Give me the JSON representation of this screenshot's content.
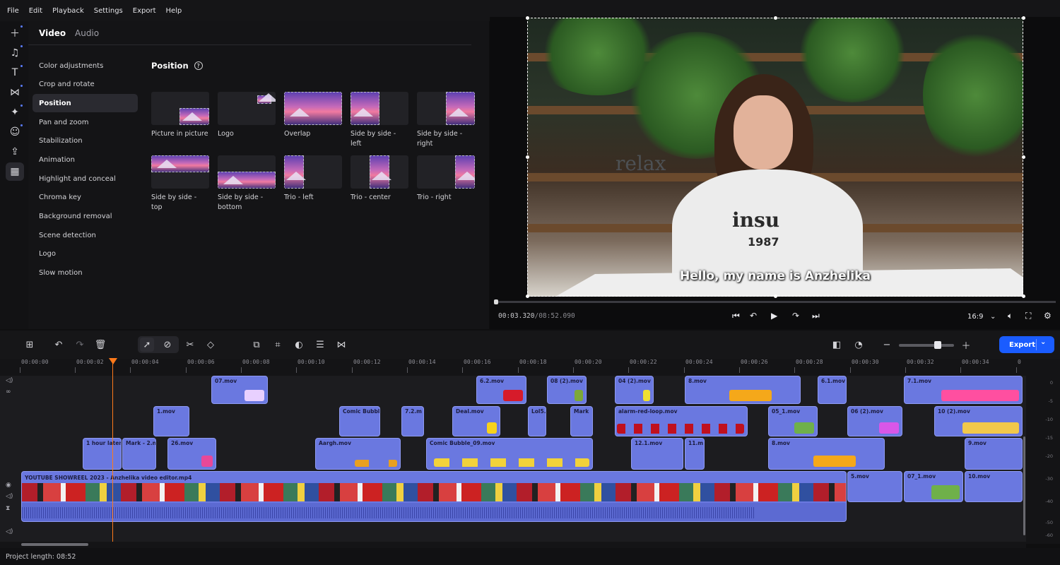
{
  "menu": [
    "File",
    "Edit",
    "Playback",
    "Settings",
    "Export",
    "Help"
  ],
  "rail_icons": [
    "add-icon",
    "music-icon",
    "text-icon",
    "transitions-icon",
    "effects-icon",
    "stickers-icon",
    "export-icon",
    "more-tools-icon"
  ],
  "panel": {
    "tabs": {
      "video": "Video",
      "audio": "Audio"
    },
    "categories": [
      "Color adjustments",
      "Crop and rotate",
      "Position",
      "Pan and zoom",
      "Stabilization",
      "Animation",
      "Highlight and conceal",
      "Chroma key",
      "Background removal",
      "Scene detection",
      "Logo",
      "Slow motion"
    ],
    "selected_category": "Position",
    "section_title": "Position",
    "help_glyph": "?",
    "presets": [
      "Picture in picture",
      "Logo",
      "Overlap",
      "Side by side - left",
      "Side by side - right",
      "Side by side - top",
      "Side by side - bottom",
      "Trio - left",
      "Trio - center",
      "Trio - right"
    ]
  },
  "viewer": {
    "caption": "Hello, my name is Anzhelika",
    "shirt_text": "insu",
    "shirt_number": "1987",
    "wall_text": "relax",
    "timecode_current": "00:03.320",
    "timecode_total": "/08:52.090",
    "aspect_ratio": "16:9",
    "ratio_caret": "⌄",
    "controls": [
      "⏮",
      "↶",
      "▶",
      "↷",
      "⏭"
    ]
  },
  "toolbar": {
    "export_label": "Export",
    "export_caret": "⌄"
  },
  "ruler": [
    "00:00:00",
    "00:00:02",
    "00:00:04",
    "00:00:06",
    "00:00:08",
    "00:00:10",
    "00:00:12",
    "00:00:14",
    "00:00:16",
    "00:00:18",
    "00:00:20",
    "00:00:22",
    "00:00:24",
    "00:00:26",
    "00:00:28",
    "00:00:30",
    "00:00:32",
    "00:00:34",
    "0"
  ],
  "clips": {
    "c07": "07.mov",
    "c62": "6.2.mov",
    "c08": "08 (2).mov",
    "c04": "04 (2).mov",
    "c8a": "8.mov",
    "c61": "6.1.mov",
    "c71": "7.1.mov",
    "c1": "1.mov",
    "cComic": "Comic Bubbl",
    "c72": "7.2.m",
    "cDeal": "Deal.mov",
    "cLol": "Lol5.",
    "cMark2": "Mark",
    "cAlarm": "alarm-red-loop.mov",
    "c051": "05_1.mov",
    "c062": "06 (2).mov",
    "c102": "10 (2).mov",
    "cHour": "1 hour later",
    "cMark": "Mark - 2.n",
    "c26": "26.mov",
    "cAargh": "Aargh.mov",
    "cComic9": "Comic Bubble_09.mov",
    "c121": "12.1.mov",
    "c11": "11.m",
    "c8b": "8.mov",
    "c9": "9.mov",
    "main": "YOUTUBE SHOWREEL 2023 - Anzhelika video editor.mp4",
    "c5": "5.mov",
    "c071": "07_1.mov",
    "c10": "10.mov"
  },
  "meter_labels": [
    "0",
    "-5",
    "-10",
    "-15",
    "-20",
    "-30",
    "-40",
    "-50",
    "-60"
  ],
  "status": {
    "project_length": "Project length: 08:52"
  },
  "colors": {
    "accent": "#1a5cff",
    "clip": "#6a78e0",
    "playhead": "#ff7a1a",
    "background": "#0f0f10"
  }
}
